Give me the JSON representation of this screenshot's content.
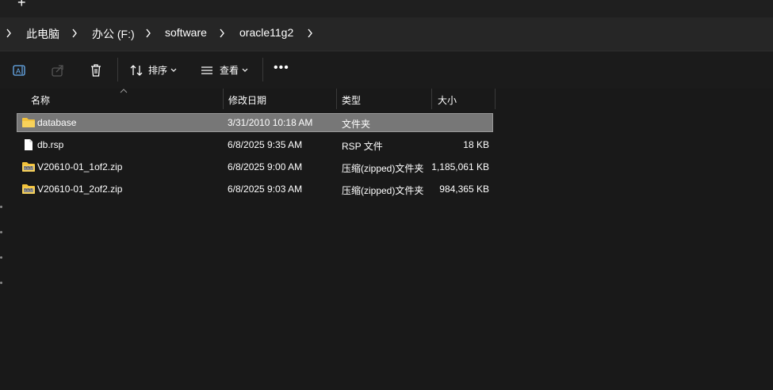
{
  "tab": {
    "new_tab_label": "+"
  },
  "breadcrumb": [
    "此电脑",
    "办公 (F:)",
    "software",
    "oracle11g2"
  ],
  "toolbar": {
    "sort_label": "排序",
    "view_label": "查看",
    "more_label": "•••"
  },
  "columns": [
    "名称",
    "修改日期",
    "类型",
    "大小"
  ],
  "files": [
    {
      "name": "database",
      "modified": "3/31/2010 10:18 AM",
      "type": "文件夹",
      "size": "",
      "icon": "folder-icon",
      "selected": true
    },
    {
      "name": "db.rsp",
      "modified": "6/8/2025 9:35 AM",
      "type": "RSP 文件",
      "size": "18 KB",
      "icon": "file-icon",
      "selected": false
    },
    {
      "name": "V20610-01_1of2.zip",
      "modified": "6/8/2025 9:00 AM",
      "type": "压缩(zipped)文件夹",
      "size": "1,185,061 KB",
      "icon": "zip-folder-icon",
      "selected": false
    },
    {
      "name": "V20610-01_2of2.zip",
      "modified": "6/8/2025 9:03 AM",
      "type": "压缩(zipped)文件夹",
      "size": "984,365 KB",
      "icon": "zip-folder-icon",
      "selected": false
    }
  ],
  "colors": {
    "background": "#191919",
    "selection": "#777777",
    "folder": "#f3c23b"
  }
}
